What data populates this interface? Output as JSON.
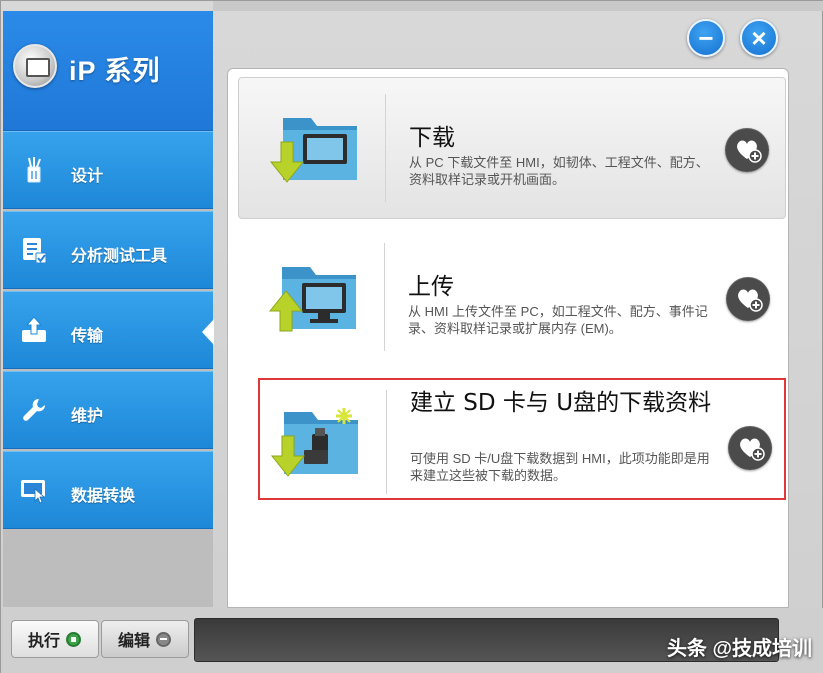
{
  "brand": {
    "title": "iP 系列"
  },
  "sidebar": {
    "items": [
      {
        "label": "设计"
      },
      {
        "label": "分析测试工具"
      },
      {
        "label": "传输"
      },
      {
        "label": "维护"
      },
      {
        "label": "数据转换"
      }
    ]
  },
  "window_controls": {
    "minimize": "−",
    "close": "×"
  },
  "cards": [
    {
      "title": "下载",
      "description": "从 PC 下载文件至 HMI，如韧体、工程文件、配方、资料取样记录或开机画面。"
    },
    {
      "title": "上传",
      "description": "从 HMI 上传文件至 PC，如工程文件、配方、事件记录、资料取样记录或扩展内存 (EM)。"
    },
    {
      "title": "建立 SD 卡与 U盘的下载资料",
      "description": "可使用 SD 卡/U盘下载数据到 HMI，此项功能即是用来建立这些被下载的数据。"
    }
  ],
  "bottom_bar": {
    "run_label": "执行",
    "edit_label": "编辑"
  },
  "watermark": "头条 @技成培训",
  "colors": {
    "sidebar_blue": "#1e88d8",
    "highlight_red": "#e0383a",
    "accent_green": "#3aa447"
  }
}
